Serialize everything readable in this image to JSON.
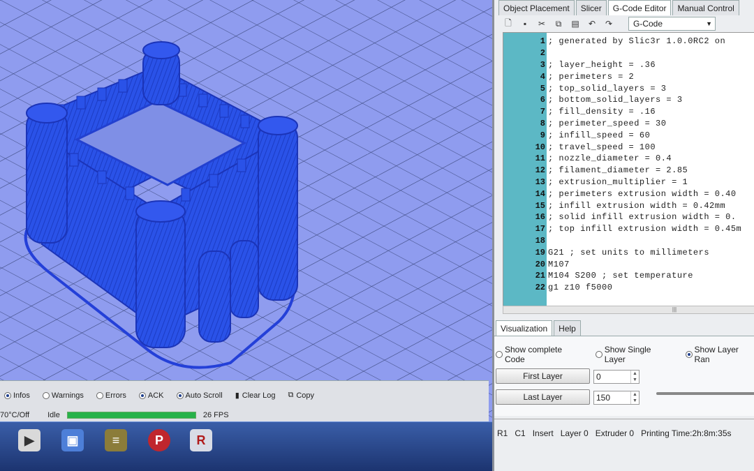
{
  "tabs": [
    {
      "label": "Object Placement",
      "active": false
    },
    {
      "label": "Slicer",
      "active": false
    },
    {
      "label": "G-Code Editor",
      "active": true
    },
    {
      "label": "Manual Control",
      "active": false
    }
  ],
  "toolbar": {
    "select_value": "G-Code",
    "icons": [
      "new-file-icon",
      "save-icon",
      "cut-icon",
      "copy-icon",
      "paste-icon",
      "undo-icon",
      "redo-icon"
    ]
  },
  "editor": {
    "lines": [
      {
        "n": "1",
        "text": "; generated by Slic3r 1.0.0RC2 on"
      },
      {
        "n": "2",
        "text": ""
      },
      {
        "n": "3",
        "text": "; layer_height = .36"
      },
      {
        "n": "4",
        "text": "; perimeters = 2"
      },
      {
        "n": "5",
        "text": "; top_solid_layers = 3"
      },
      {
        "n": "6",
        "text": "; bottom_solid_layers = 3"
      },
      {
        "n": "7",
        "text": "; fill_density = .16"
      },
      {
        "n": "8",
        "text": "; perimeter_speed = 30"
      },
      {
        "n": "9",
        "text": "; infill_speed = 60"
      },
      {
        "n": "10",
        "text": "; travel_speed = 100"
      },
      {
        "n": "11",
        "text": "; nozzle_diameter = 0.4"
      },
      {
        "n": "12",
        "text": "; filament_diameter = 2.85"
      },
      {
        "n": "13",
        "text": "; extrusion_multiplier = 1"
      },
      {
        "n": "14",
        "text": "; perimeters extrusion width = 0.40"
      },
      {
        "n": "15",
        "text": "; infill extrusion width = 0.42mm"
      },
      {
        "n": "16",
        "text": "; solid infill extrusion width = 0."
      },
      {
        "n": "17",
        "text": "; top infill extrusion width = 0.45m"
      },
      {
        "n": "18",
        "text": ""
      },
      {
        "n": "19",
        "text": "G21 ; set units to millimeters"
      },
      {
        "n": "20",
        "text": "M107"
      },
      {
        "n": "21",
        "text": "M104 S200 ; set temperature"
      },
      {
        "n": "22",
        "text": "g1 z10 f5000"
      }
    ]
  },
  "viz": {
    "tabs": [
      {
        "label": "Visualization",
        "active": true
      },
      {
        "label": "Help",
        "active": false
      }
    ],
    "options": [
      {
        "label": "Show complete Code",
        "selected": false
      },
      {
        "label": "Show Single Layer",
        "selected": false
      },
      {
        "label": "Show Layer Ran",
        "selected": true
      }
    ],
    "first_layer_label": "First Layer",
    "first_layer_value": "0",
    "last_layer_label": "Last Layer",
    "last_layer_value": "150"
  },
  "status": {
    "r1": "R1",
    "c1": "C1",
    "insert": "Insert",
    "layer": "Layer 0",
    "extruder": "Extruder 0",
    "print_time": "Printing Time:2h:8m:35s"
  },
  "log": {
    "filters": [
      {
        "label": "Infos",
        "selected": true
      },
      {
        "label": "Warnings",
        "selected": false
      },
      {
        "label": "Errors",
        "selected": false
      },
      {
        "label": "ACK",
        "selected": true
      },
      {
        "label": "Auto Scroll",
        "selected": true
      }
    ],
    "clear_label": "Clear Log",
    "copy_label": "Copy",
    "temp_label": "70°C/Off",
    "idle_label": "Idle",
    "progress": 1.0,
    "fps_label": "26 FPS"
  },
  "colors": {
    "viewport": "#8f9cef",
    "grid": "#3d4a80",
    "model": "#2a52e8",
    "gutter": "#5cb8c5"
  }
}
